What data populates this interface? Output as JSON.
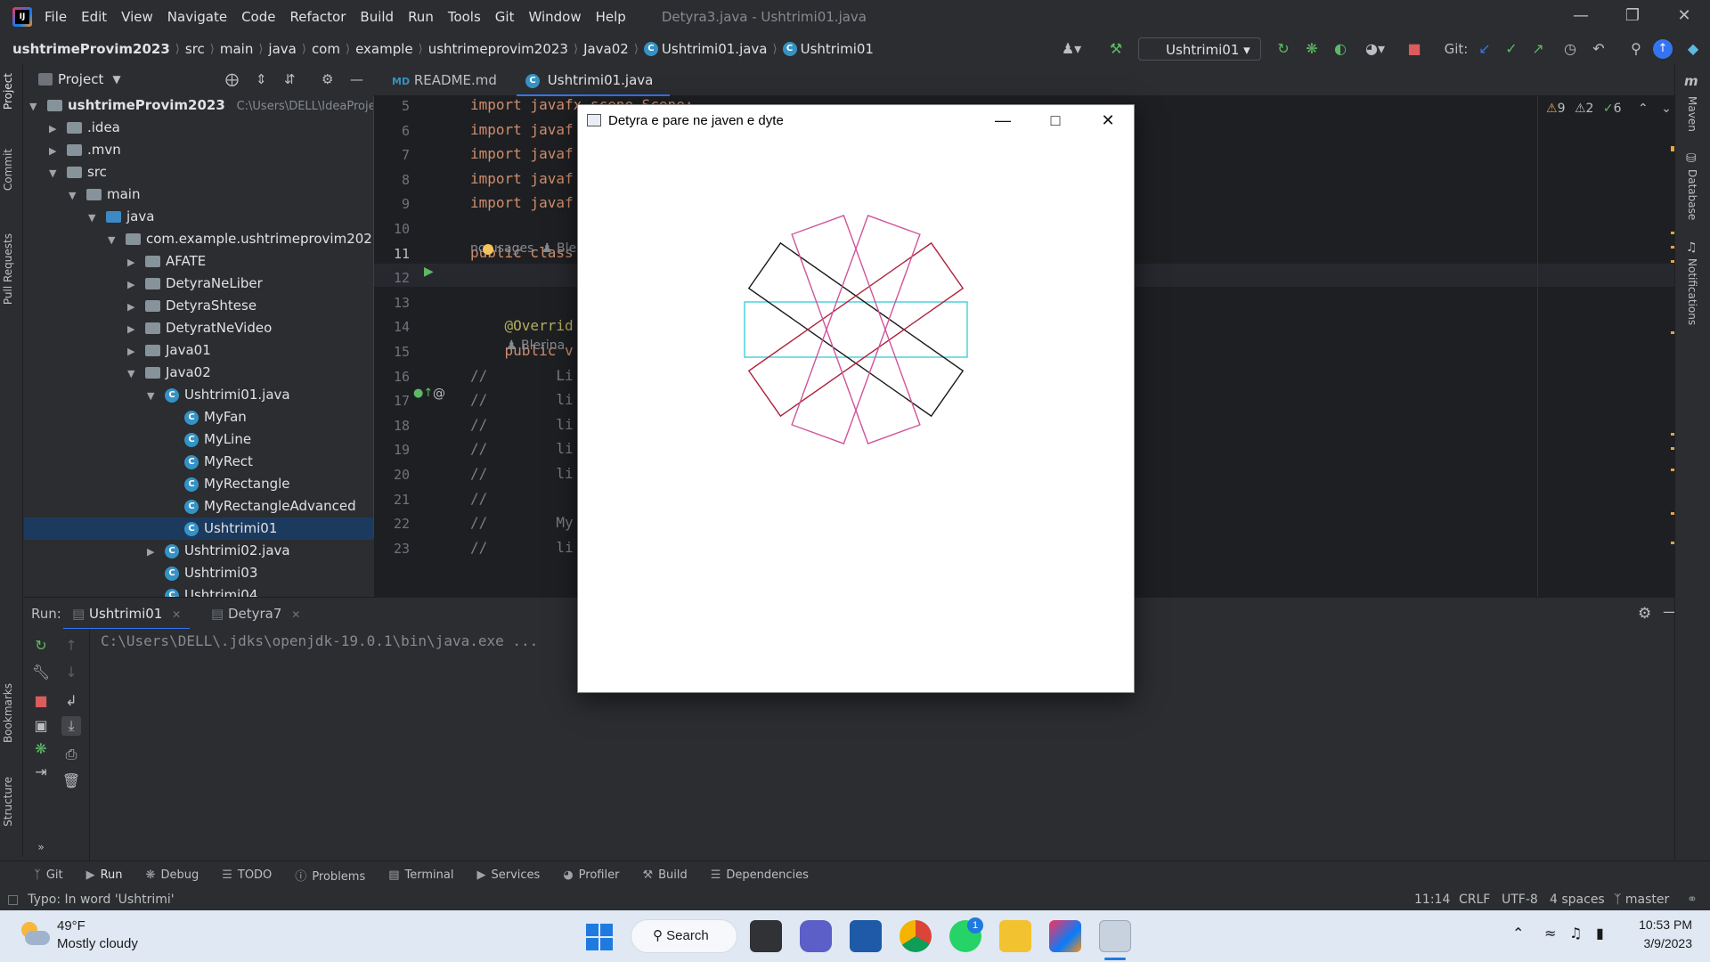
{
  "menu": {
    "items": [
      "File",
      "Edit",
      "View",
      "Navigate",
      "Code",
      "Refactor",
      "Build",
      "Run",
      "Tools",
      "Git",
      "Window",
      "Help"
    ],
    "title": "Detyra3.java - Ushtrimi01.java"
  },
  "breadcrumb": [
    "ushtrimeProvim2023",
    "src",
    "main",
    "java",
    "com",
    "example",
    "ushtrimeprovim2023",
    "Java02",
    "Ushtrimi01.java",
    "Ushtrimi01"
  ],
  "toolbar": {
    "run_config": "Ushtrimi01",
    "git_label": "Git:"
  },
  "project_panel": {
    "title": "Project",
    "root": "ushtrimeProvim2023",
    "root_path": "C:\\Users\\DELL\\IdeaProjects",
    "tree": [
      {
        "label": ".idea",
        "depth": 1,
        "kind": "folder",
        "expand": "collapsed"
      },
      {
        "label": ".mvn",
        "depth": 1,
        "kind": "folder",
        "expand": "collapsed"
      },
      {
        "label": "src",
        "depth": 1,
        "kind": "folder",
        "expand": "expanded"
      },
      {
        "label": "main",
        "depth": 2,
        "kind": "folder",
        "expand": "expanded"
      },
      {
        "label": "java",
        "depth": 3,
        "kind": "folder-blue",
        "expand": "expanded"
      },
      {
        "label": "com.example.ushtrimeprovim2023",
        "depth": 4,
        "kind": "package",
        "expand": "expanded"
      },
      {
        "label": "AFATE",
        "depth": 5,
        "kind": "package",
        "expand": "collapsed"
      },
      {
        "label": "DetyraNeLiber",
        "depth": 5,
        "kind": "package",
        "expand": "collapsed"
      },
      {
        "label": "DetyraShtese",
        "depth": 5,
        "kind": "package",
        "expand": "collapsed"
      },
      {
        "label": "DetyratNeVideo",
        "depth": 5,
        "kind": "package",
        "expand": "collapsed"
      },
      {
        "label": "Java01",
        "depth": 5,
        "kind": "package",
        "expand": "collapsed"
      },
      {
        "label": "Java02",
        "depth": 5,
        "kind": "package",
        "expand": "expanded"
      },
      {
        "label": "Ushtrimi01.java",
        "depth": 6,
        "kind": "javafile",
        "expand": "expanded"
      },
      {
        "label": "MyFan",
        "depth": 7,
        "kind": "class",
        "expand": "none"
      },
      {
        "label": "MyLine",
        "depth": 7,
        "kind": "class",
        "expand": "none"
      },
      {
        "label": "MyRect",
        "depth": 7,
        "kind": "class",
        "expand": "none"
      },
      {
        "label": "MyRectangle",
        "depth": 7,
        "kind": "class",
        "expand": "none"
      },
      {
        "label": "MyRectangleAdvanced",
        "depth": 7,
        "kind": "class",
        "expand": "none"
      },
      {
        "label": "Ushtrimi01",
        "depth": 7,
        "kind": "class",
        "expand": "none",
        "selected": true
      },
      {
        "label": "Ushtrimi02.java",
        "depth": 6,
        "kind": "javafile",
        "expand": "collapsed"
      },
      {
        "label": "Ushtrimi03",
        "depth": 6,
        "kind": "class",
        "expand": "none"
      },
      {
        "label": "Ushtrimi04",
        "depth": 6,
        "kind": "class",
        "expand": "none"
      }
    ]
  },
  "editor": {
    "tabs": [
      "README.md",
      "Ushtrimi01.java"
    ],
    "inspections": {
      "warnings": "9",
      "weak_warnings": "2",
      "ok": "6"
    },
    "lines": [
      {
        "n": "5",
        "text": "import javafx.scene.Scene;"
      },
      {
        "n": "6",
        "text": "import javaf"
      },
      {
        "n": "7",
        "text": "import javaf"
      },
      {
        "n": "8",
        "text": "import javaf"
      },
      {
        "n": "9",
        "text": "import javaf"
      },
      {
        "n": "10",
        "text": ""
      },
      {
        "n": "11",
        "text": "public class"
      },
      {
        "n": "12",
        "text": ""
      },
      {
        "n": "13",
        "text": ""
      },
      {
        "n": "14",
        "text": "    @Overrid"
      },
      {
        "n": "15",
        "text": "    public v"
      },
      {
        "n": "16",
        "text": "//        Li"
      },
      {
        "n": "17",
        "text": "//        li"
      },
      {
        "n": "18",
        "text": "//        li"
      },
      {
        "n": "19",
        "text": "//        li"
      },
      {
        "n": "20",
        "text": "//        li"
      },
      {
        "n": "21",
        "text": "//"
      },
      {
        "n": "22",
        "text": "//        My"
      },
      {
        "n": "23",
        "text": "//        li"
      }
    ],
    "usages_hint": "no usages",
    "author_hint": "Ble",
    "author_hint2": "Blerina"
  },
  "run_panel": {
    "label": "Run:",
    "tabs": [
      "Ushtrimi01",
      "Detyra7"
    ],
    "console": "C:\\Users\\DELL\\.jdks\\openjdk-19.0.1\\bin\\java.exe ..."
  },
  "bottom_tools": [
    "Git",
    "Run",
    "Debug",
    "TODO",
    "Problems",
    "Terminal",
    "Services",
    "Profiler",
    "Build",
    "Dependencies"
  ],
  "left_tabs": [
    "Project",
    "Commit",
    "Pull Requests",
    "Bookmarks",
    "Structure"
  ],
  "right_tabs": [
    "Maven",
    "Database",
    "Notifications"
  ],
  "status": {
    "message": "Typo: In word 'Ushtrimi'",
    "position": "11:14",
    "line_sep": "CRLF",
    "encoding": "UTF-8",
    "indent": "4 spaces",
    "branch": "master"
  },
  "fx_window": {
    "title": "Detyra e pare ne javen e dyte",
    "shapes": [
      {
        "name": "cyan-rect",
        "stroke": "#40d0d8",
        "angle": 0
      },
      {
        "name": "black-rect",
        "stroke": "#1a1a1a",
        "angle": 35
      },
      {
        "name": "darkred-rect",
        "stroke": "#b0203a",
        "angle": -35
      },
      {
        "name": "pink-rect-1",
        "stroke": "#d0559a",
        "angle": 70
      },
      {
        "name": "pink-rect-2",
        "stroke": "#d0559a",
        "angle": -70
      }
    ]
  },
  "taskbar": {
    "weather_temp": "49°F",
    "weather_desc": "Mostly cloudy",
    "search": "Search",
    "time": "10:53 PM",
    "date": "3/9/2023",
    "whatsapp_badge": "1"
  }
}
